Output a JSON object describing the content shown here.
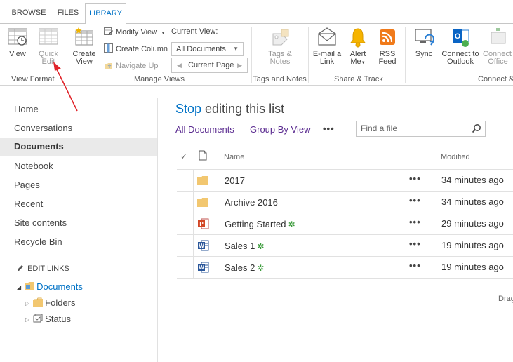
{
  "tabs": {
    "browse": "BROWSE",
    "files": "FILES",
    "library": "LIBRARY"
  },
  "ribbon": {
    "view": "View",
    "quick_edit_line1": "Quick",
    "quick_edit_line2": "Edit",
    "create_view_line1": "Create",
    "create_view_line2": "View",
    "modify_view": "Modify View",
    "create_column": "Create Column",
    "navigate_up": "Navigate Up",
    "current_view_label": "Current View:",
    "current_view_value": "All Documents",
    "current_page": "Current Page",
    "tags_line1": "Tags &",
    "tags_line2": "Notes",
    "email_line1": "E-mail a",
    "email_line2": "Link",
    "alert_line1": "Alert",
    "alert_line2": "Me",
    "rss_line1": "RSS",
    "rss_line2": "Feed",
    "sync": "Sync",
    "outlook_line1": "Connect to",
    "outlook_line2": "Outlook",
    "office_line1": "Connect to",
    "office_line2": "Office",
    "groups": {
      "view_format": "View Format",
      "manage_views": "Manage Views",
      "tags_and_notes": "Tags and Notes",
      "share_track": "Share & Track",
      "connect": "Connect &"
    }
  },
  "nav": {
    "items": [
      "Home",
      "Conversations",
      "Documents",
      "Notebook",
      "Pages",
      "Recent",
      "Site contents",
      "Recycle Bin"
    ],
    "active": "Documents",
    "edit_links": "EDIT LINKS",
    "tree": {
      "documents": "Documents",
      "folders": "Folders",
      "status": "Status"
    }
  },
  "main": {
    "title_stop": "Stop",
    "title_rest": " editing this list",
    "views": {
      "all_documents": "All Documents",
      "group_by_view": "Group By View",
      "more": "•••"
    },
    "search_placeholder": "Find a file",
    "columns": {
      "name": "Name",
      "modified": "Modified"
    },
    "rows": [
      {
        "name": "2017",
        "type": "folder",
        "modified": "34 minutes ago",
        "new": false
      },
      {
        "name": "Archive 2016",
        "type": "folder",
        "modified": "34 minutes ago",
        "new": false
      },
      {
        "name": "Getting Started",
        "type": "powerpoint",
        "modified": "29 minutes ago",
        "new": true
      },
      {
        "name": "Sales 1",
        "type": "word",
        "modified": "19 minutes ago",
        "new": true
      },
      {
        "name": "Sales 2",
        "type": "word",
        "modified": "19 minutes ago",
        "new": true
      }
    ],
    "row_menu": "•••",
    "drag_hint": "Drag"
  },
  "colors": {
    "accent": "#0072c6",
    "annotation_arrow": "#e0242a",
    "folder": "#f2c770",
    "new_mark": "#3a9b3a"
  }
}
